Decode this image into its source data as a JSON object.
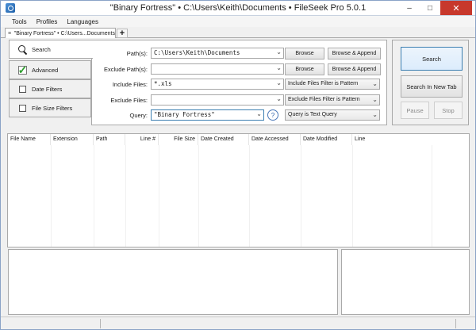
{
  "window": {
    "title": "\"Binary Fortress\" • C:\\Users\\Keith\\Documents • FileSeek Pro 5.0.1"
  },
  "menu": [
    "Tools",
    "Profiles",
    "Languages"
  ],
  "doc_tab": {
    "label": "\"Binary Fortress\" • C:\\Users...Documents"
  },
  "side_tabs": [
    {
      "label": "Search"
    },
    {
      "label": "Advanced"
    },
    {
      "label": "Date Filters"
    },
    {
      "label": "File Size Filters"
    }
  ],
  "form": {
    "paths": {
      "label": "Path(s):",
      "value": "C:\\Users\\Keith\\Documents",
      "browse": "Browse",
      "browse_append": "Browse & Append"
    },
    "exclude_paths": {
      "label": "Exclude Path(s):",
      "value": "",
      "browse": "Browse",
      "browse_append": "Browse & Append"
    },
    "include_files": {
      "label": "Include Files:",
      "value": "*.xls",
      "mode": "Include Files Filter is Pattern"
    },
    "exclude_files": {
      "label": "Exclude Files:",
      "value": "",
      "mode": "Exclude Files Filter is Pattern"
    },
    "query": {
      "label": "Query:",
      "value": "\"Binary Fortress\"",
      "mode": "Query is Text Query"
    }
  },
  "actions": {
    "search": "Search",
    "search_new_tab": "Search In New Tab",
    "pause": "Pause",
    "stop": "Stop"
  },
  "columns": [
    "File Name",
    "Extension",
    "Path",
    "Line #",
    "File Size",
    "Date Created",
    "Date Accessed",
    "Date Modified",
    "Line"
  ]
}
